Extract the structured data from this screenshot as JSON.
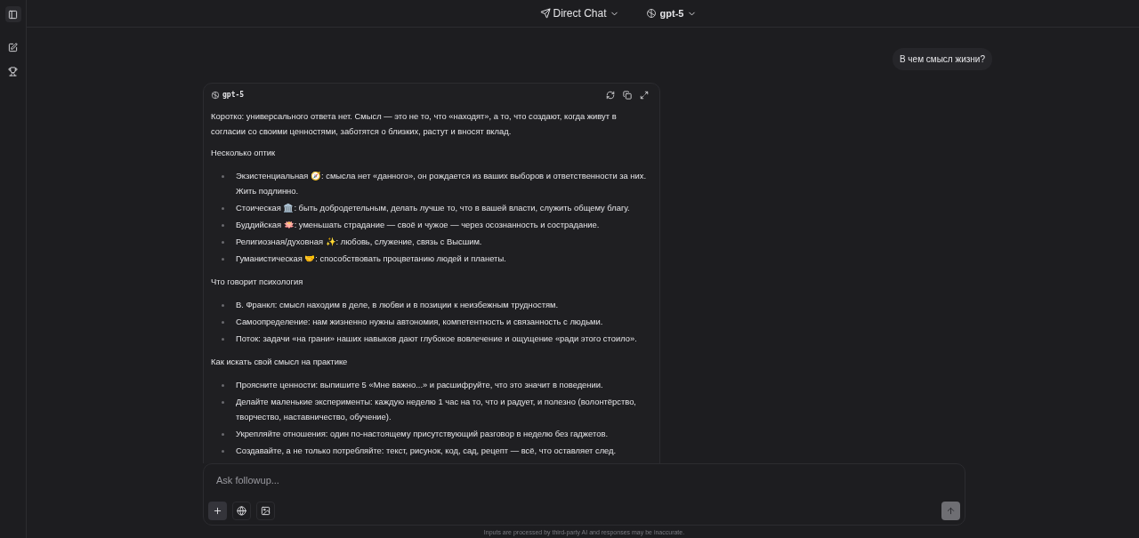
{
  "header": {
    "mode": "Direct Chat",
    "model": "gpt-5"
  },
  "user_message": "В чем смысл жизни?",
  "response": {
    "model": "gpt-5",
    "blocks": [
      {
        "kind": "paragraph",
        "text": "Коротко: универсального ответа нет. Смысл — это не то, что «находят», а то, что создают, когда живут в согласии со своими ценностями, заботятся о близких, растут и вносят вклад."
      },
      {
        "kind": "heading",
        "text": "Несколько оптик"
      },
      {
        "kind": "list",
        "items": [
          "Экзистенциальная 🧭: смысла нет «данного», он рождается из ваших выборов и ответственности за них. Жить подлинно.",
          "Стоическая 🏛️: быть добродетельным, делать лучше то, что в вашей власти, служить общему благу.",
          "Буддийская 🪷: уменьшать страдание — своё и чужое — через осознанность и сострадание.",
          "Религиозная/духовная ✨: любовь, служение, связь с Высшим.",
          "Гуманистическая 🤝: способствовать процветанию людей и планеты."
        ]
      },
      {
        "kind": "heading",
        "text": "Что говорит психология"
      },
      {
        "kind": "list",
        "items": [
          "В. Франкл: смысл находим в деле, в любви и в позиции к неизбежным трудностям.",
          "Самоопределение: нам жизненно нужны автономия, компетентность и связанность с людьми.",
          "Поток: задачи «на грани» наших навыков дают глубокое вовлечение и ощущение «ради этого стоило»."
        ]
      },
      {
        "kind": "heading",
        "text": "Как искать свой смысл на практике"
      },
      {
        "kind": "list",
        "items": [
          "Проясните ценности: выпишите 5 «Мне важно...» и расшифруйте, что это значит в поведении.",
          "Делайте маленькие эксперименты: каждую неделю 1 час на то, что и радует, и полезно (волонтёрство, творчество, наставничество, обучение).",
          "Укрепляйте отношения: один по-настоящему присутствующий разговор в неделю без гаджетов.",
          "Создавайте, а не только потребляйте: текст, рисунок, код, сад, рецепт — всё, что оставляет след."
        ]
      }
    ]
  },
  "composer": {
    "placeholder": "Ask followup...",
    "disclaimer": "Inputs are processed by third-party AI and responses may be inaccurate."
  }
}
